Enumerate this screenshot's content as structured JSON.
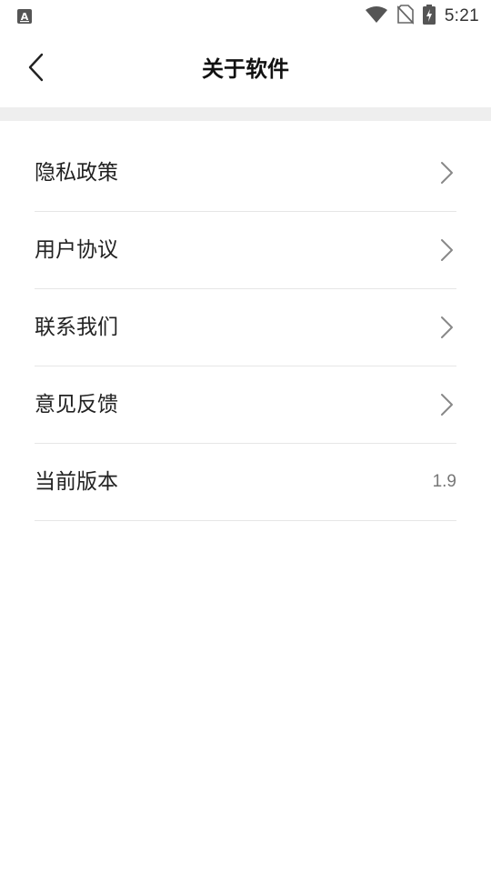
{
  "status_bar": {
    "left_icon": "app-notification-icon",
    "time": "5:21",
    "icons": [
      "wifi-icon",
      "no-sim-icon",
      "battery-charging-icon"
    ]
  },
  "header": {
    "title": "关于软件",
    "back_icon": "chevron-left-icon"
  },
  "menu": {
    "items": [
      {
        "label": "隐私政策",
        "icon": "chevron-right-icon"
      },
      {
        "label": "用户协议",
        "icon": "chevron-right-icon"
      },
      {
        "label": "联系我们",
        "icon": "chevron-right-icon"
      },
      {
        "label": "意见反馈",
        "icon": "chevron-right-icon"
      },
      {
        "label": "当前版本",
        "value": "1.9"
      }
    ]
  },
  "colors": {
    "background": "#ffffff",
    "divider_band": "#eeeeee",
    "row_divider": "#e6e6e6",
    "text_primary": "#222222",
    "text_secondary": "#777777",
    "chevron": "#888888"
  }
}
